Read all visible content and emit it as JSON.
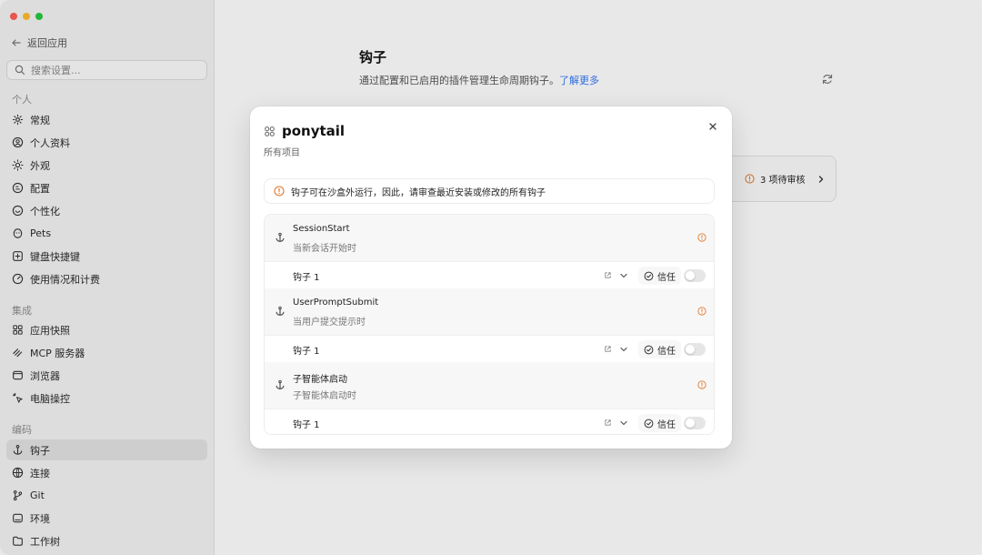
{
  "sidebar": {
    "back_label": "返回应用",
    "search_placeholder": "搜索设置...",
    "sections": [
      {
        "label": "个人",
        "items": [
          {
            "label": "常规",
            "icon": "gear-icon"
          },
          {
            "label": "个人资料",
            "icon": "user-circle-icon"
          },
          {
            "label": "外观",
            "icon": "sun-icon"
          },
          {
            "label": "配置",
            "icon": "config-icon"
          },
          {
            "label": "个性化",
            "icon": "personalize-icon"
          },
          {
            "label": "Pets",
            "icon": "pet-icon"
          },
          {
            "label": "键盘快捷键",
            "icon": "keyboard-icon"
          },
          {
            "label": "使用情况和计费",
            "icon": "gauge-icon"
          }
        ]
      },
      {
        "label": "集成",
        "items": [
          {
            "label": "应用快照",
            "icon": "app-grid-icon"
          },
          {
            "label": "MCP 服务器",
            "icon": "mcp-icon"
          },
          {
            "label": "浏览器",
            "icon": "browser-icon"
          },
          {
            "label": "电脑操控",
            "icon": "cursor-icon"
          }
        ]
      },
      {
        "label": "编码",
        "items": [
          {
            "label": "钩子",
            "icon": "anchor-icon",
            "active": true
          },
          {
            "label": "连接",
            "icon": "globe-icon"
          },
          {
            "label": "Git",
            "icon": "git-branch-icon"
          },
          {
            "label": "环境",
            "icon": "terminal-icon"
          },
          {
            "label": "工作树",
            "icon": "folder-icon"
          }
        ]
      }
    ]
  },
  "main": {
    "title": "钩子",
    "subtitle": "通过配置和已启用的插件管理生命周期钩子。",
    "learn_more": "了解更多",
    "review_label": "3 项待审核"
  },
  "modal": {
    "title": "ponytail",
    "subtitle": "所有项目",
    "warning": "钩子可在沙盒外运行，因此，请审查最近安装或修改的所有钩子",
    "hooks": [
      {
        "title": "SessionStart",
        "description": "当新会话开始时",
        "row_label": "钩子 1",
        "trust_label": "信任"
      },
      {
        "title": "UserPromptSubmit",
        "description": "当用户提交提示时",
        "row_label": "钩子 1",
        "trust_label": "信任"
      },
      {
        "title": "子智能体启动",
        "description": "子智能体启动时",
        "row_label": "钩子 1",
        "trust_label": "信任"
      }
    ]
  },
  "colors": {
    "accent_link": "#3478f6",
    "warning": "#e07a2e",
    "sidebar_bg": "#f3f3f3"
  }
}
